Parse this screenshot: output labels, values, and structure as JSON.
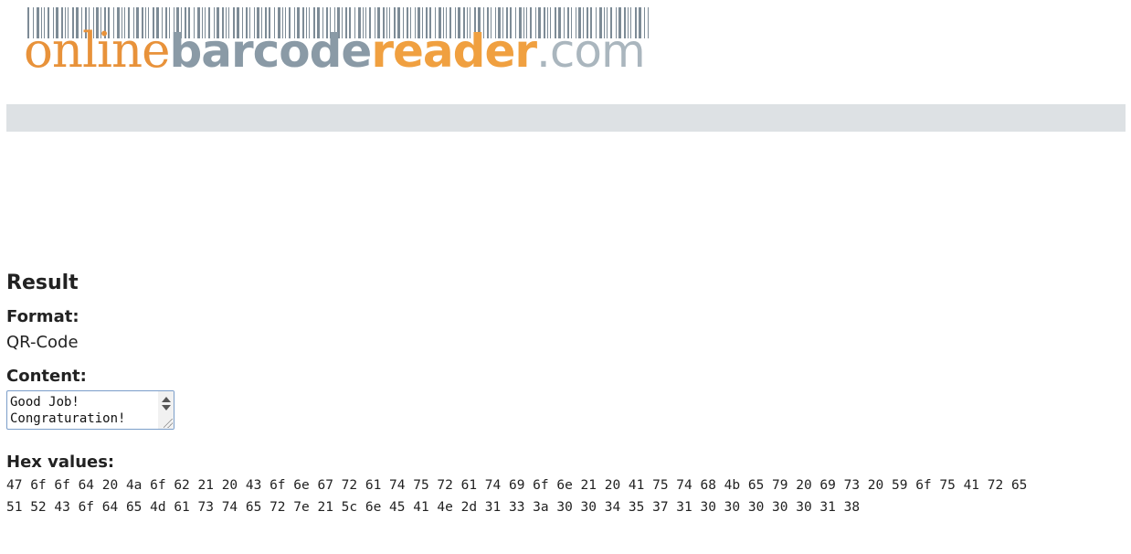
{
  "logo": {
    "part1": "online",
    "part2": "barcode",
    "part3": "reader",
    "part4": ".com"
  },
  "result": {
    "title": "Result",
    "format_label": "Format:",
    "format_value": "QR-Code",
    "content_label": "Content:",
    "content_value": "Good Job!\nCongraturation!",
    "hex_label": "Hex values:",
    "hex_line_1": "47 6f 6f 64 20 4a 6f 62 21 20 43 6f 6e 67 72 61 74 75 72 61 74 69 6f 6e 21 20 41 75 74 68 4b 65 79 20 69 73 20 59 6f 75 41 72 65",
    "hex_line_2": "51 52 43 6f 64 65 4d 61 73 74 65 72 7e 21 5c 6e 45 41 4e 2d 31 33 3a 30 30 34 35 37 31 30 30 30 30 30 31 38"
  },
  "colors": {
    "logo_orange": "#e8923a",
    "logo_gray": "#8a9aa6",
    "nav_bar": "#dde1e4",
    "textarea_border": "#7b9ec9"
  }
}
